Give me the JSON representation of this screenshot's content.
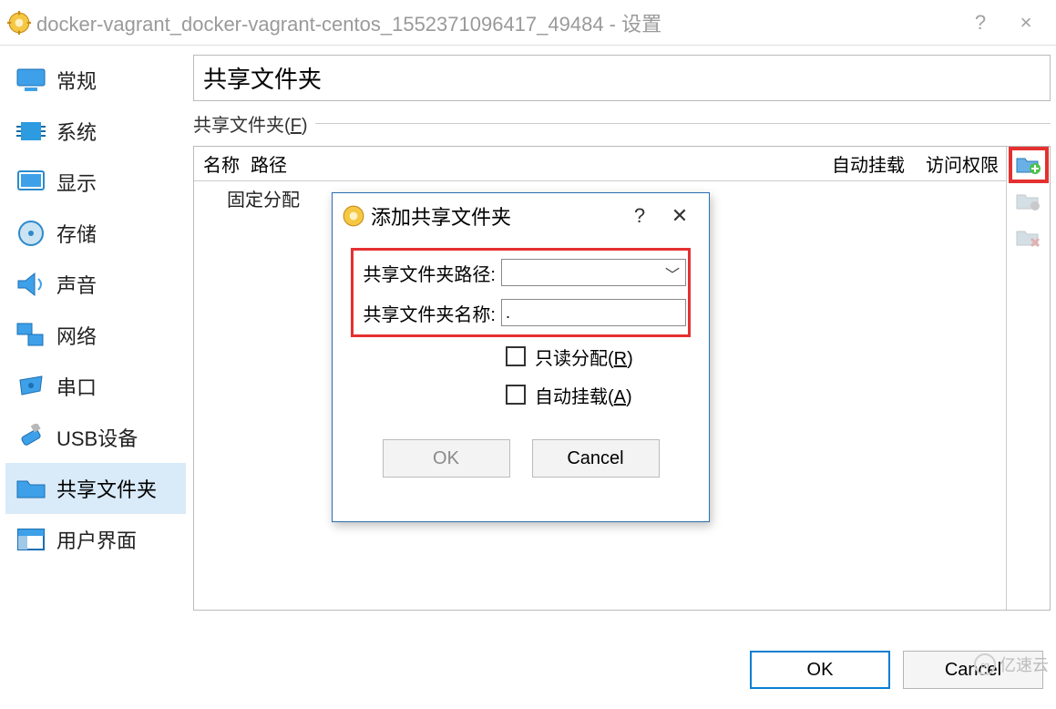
{
  "window": {
    "title": "docker-vagrant_docker-vagrant-centos_1552371096417_49484 - 设置",
    "help_symbol": "?",
    "close_symbol": "×"
  },
  "sidebar": {
    "items": [
      {
        "label": "常规",
        "icon": "monitor-icon"
      },
      {
        "label": "系统",
        "icon": "chip-icon"
      },
      {
        "label": "显示",
        "icon": "display-icon"
      },
      {
        "label": "存储",
        "icon": "disk-icon"
      },
      {
        "label": "声音",
        "icon": "speaker-icon"
      },
      {
        "label": "网络",
        "icon": "network-icon"
      },
      {
        "label": "串口",
        "icon": "serial-icon"
      },
      {
        "label": "USB设备",
        "icon": "usb-icon"
      },
      {
        "label": "共享文件夹",
        "icon": "folder-icon"
      },
      {
        "label": "用户界面",
        "icon": "ui-icon"
      }
    ],
    "selected_index": 8
  },
  "panel": {
    "title": "共享文件夹",
    "group_label": "共享文件夹(",
    "group_hotkey": "F",
    "group_label_close": ")",
    "columns": {
      "name": "名称",
      "path": "路径",
      "automount": "自动挂载",
      "permission": "访问权限"
    },
    "fixed_row": "固定分配",
    "toolbar": {
      "add": "add-folder-icon",
      "edit": "edit-folder-icon",
      "remove": "remove-folder-icon"
    }
  },
  "modal": {
    "title": "添加共享文件夹",
    "help_symbol": "?",
    "close_symbol": "✕",
    "path_label": "共享文件夹路径:",
    "path_value": "",
    "name_label": "共享文件夹名称:",
    "name_value": ".",
    "readonly_label": "只读分配(",
    "readonly_hotkey": "R",
    "readonly_close": ")",
    "automount_label": "自动挂载(",
    "automount_hotkey": "A",
    "automount_close": ")",
    "ok_label": "OK",
    "cancel_label": "Cancel"
  },
  "buttons": {
    "ok": "OK",
    "cancel": "Cancel"
  },
  "watermark": {
    "text": "亿速云"
  }
}
